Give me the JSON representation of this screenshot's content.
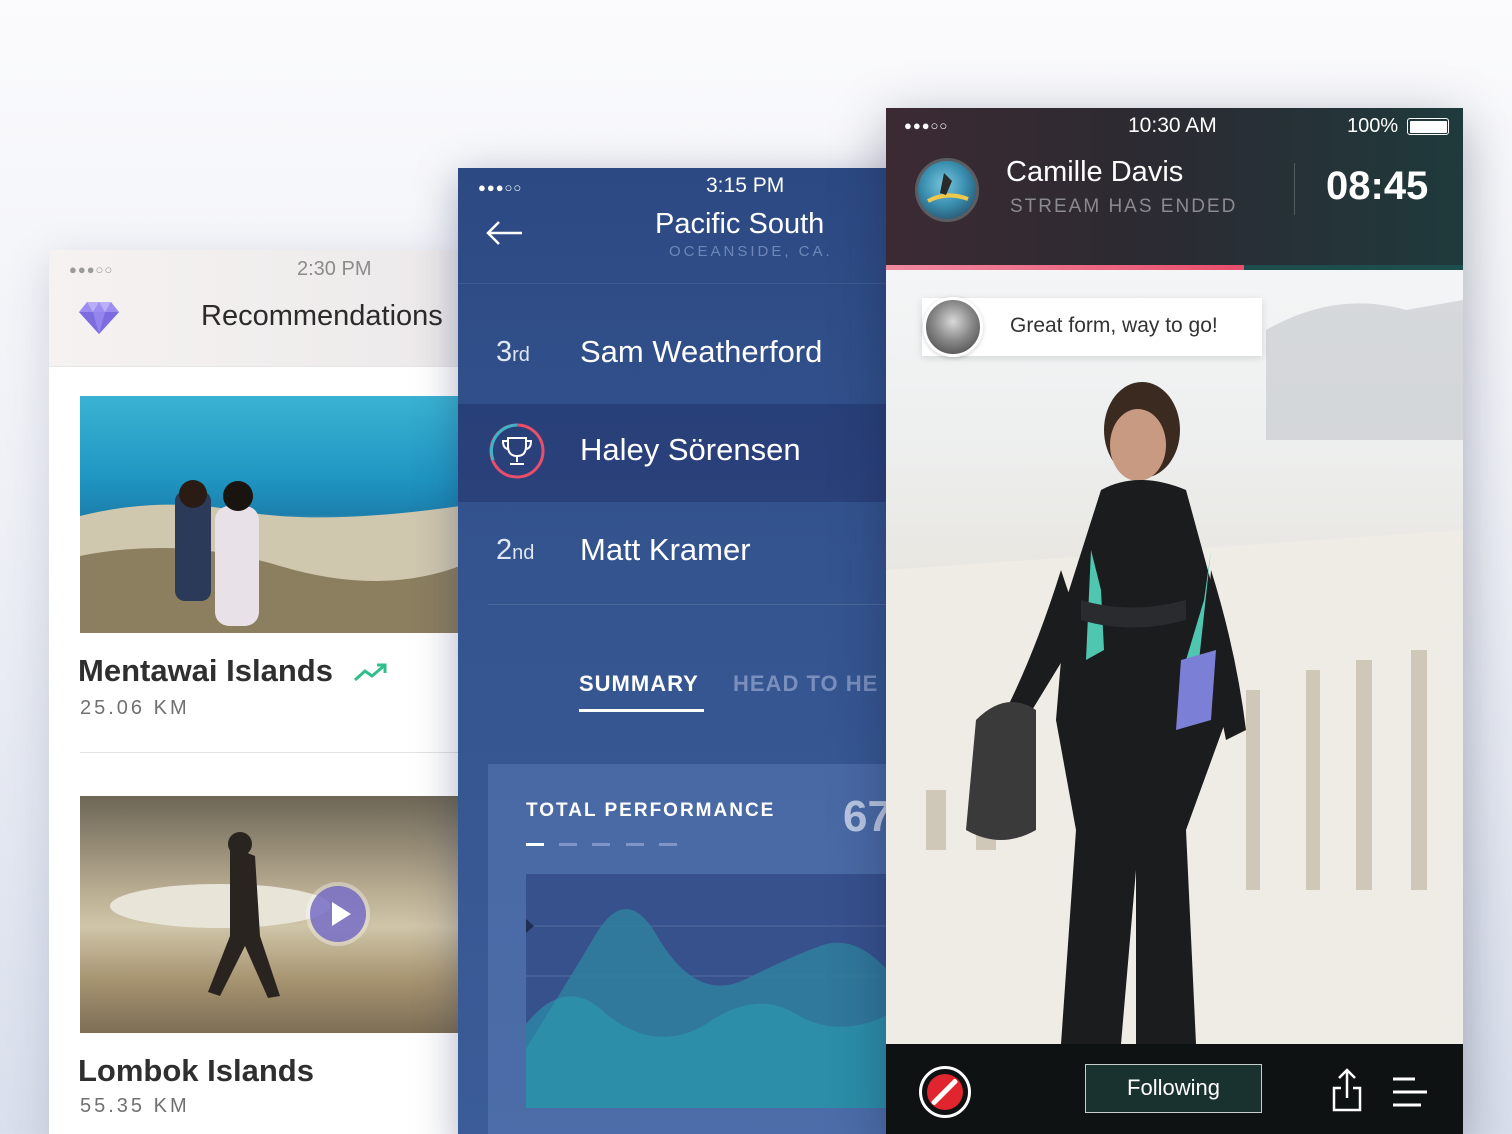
{
  "screen_recommendations": {
    "status": {
      "time": "2:30 PM"
    },
    "title": "Recommendations",
    "places": [
      {
        "name": "Mentawai Islands",
        "distance": "25.06 KM"
      },
      {
        "name": "Lombok Islands",
        "distance": "55.35 KM"
      }
    ]
  },
  "screen_leaderboard": {
    "status": {
      "time": "3:15 PM"
    },
    "title": "Pacific South",
    "subtitle": "OCEANSIDE, CA.",
    "rows": [
      {
        "rank": "3",
        "suffix": "rd",
        "name": "Sam Weatherford"
      },
      {
        "name": "Haley Sörensen"
      },
      {
        "rank": "2",
        "suffix": "nd",
        "name": "Matt Kramer"
      }
    ],
    "tabs": [
      {
        "label": "SUMMARY"
      },
      {
        "label": "HEAD TO HE"
      }
    ],
    "performance": {
      "label": "TOTAL PERFORMANCE",
      "value": "67"
    }
  },
  "screen_stream": {
    "status": {
      "time": "10:30 AM",
      "battery": "100%"
    },
    "user_name": "Camille Davis",
    "stream_status": "STREAM HAS ENDED",
    "timer": "08:45",
    "progress_fraction": 0.62,
    "comment": "Great form, way to go!",
    "follow_label": "Following"
  },
  "colors": {
    "accent_pink": "#e94e6b",
    "accent_teal": "#1e4d4e",
    "leaderboard_blue": "#34548f",
    "record_red": "#e0252e"
  }
}
